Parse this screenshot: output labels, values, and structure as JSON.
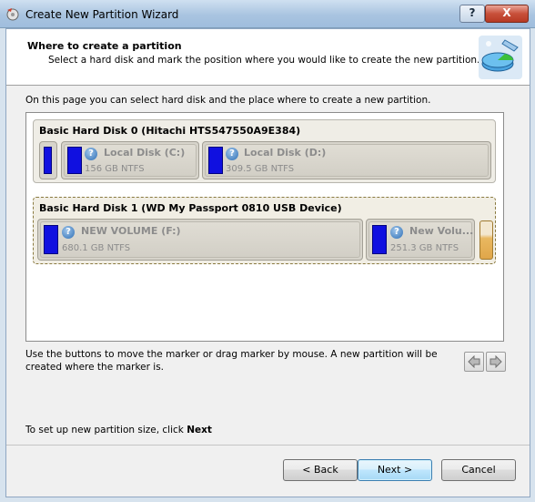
{
  "window": {
    "title": "Create New Partition Wizard",
    "help_label": "?",
    "close_label": "X"
  },
  "header": {
    "title": "Where to create a partition",
    "subtitle": "Select a hard disk and mark the position where you would like to create the new partition."
  },
  "intro": "On this page you can select hard disk and the place where to create a new partition.",
  "disks": [
    {
      "title": "Basic Hard Disk 0 (Hitachi HTS547550A9E384)",
      "partitions": [
        {
          "name": "Local Disk (C:)",
          "size": "156 GB NTFS"
        },
        {
          "name": "Local Disk (D:)",
          "size": "309.5 GB NTFS"
        }
      ]
    },
    {
      "title": "Basic Hard Disk 1 (WD My Passport 0810 USB Device)",
      "partitions": [
        {
          "name": "NEW VOLUME (F:)",
          "size": "680.1 GB NTFS"
        },
        {
          "name": "New Volu...",
          "size": "251.3 GB NTFS"
        }
      ]
    }
  ],
  "hint": "Use the buttons to move the marker or drag marker by mouse. A new partition will be created where the marker is.",
  "size_hint": {
    "prefix": "To set up new partition size, click ",
    "action": "Next"
  },
  "buttons": {
    "back": "< Back",
    "next": "Next >",
    "cancel": "Cancel"
  },
  "colors": {
    "partition_bar": "#1010e0",
    "marker": "#e0a64a"
  }
}
